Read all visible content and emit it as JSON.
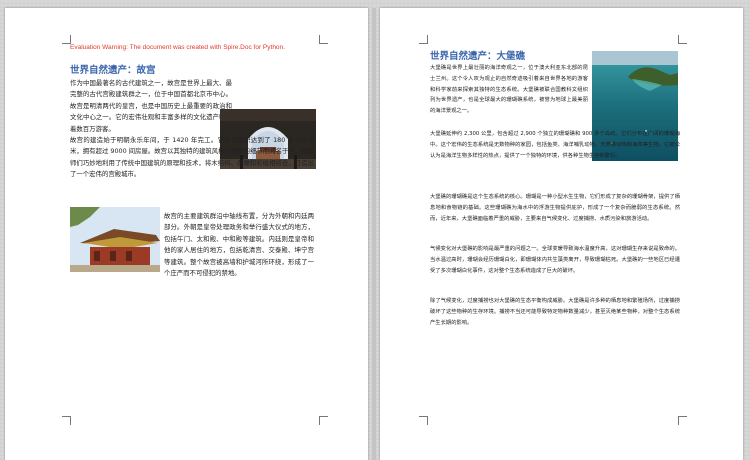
{
  "document": {
    "warning": "Evaluation Warning: The document was created with Spire.Doc for Python.",
    "page1": {
      "heading": "世界自然遗产：故宫",
      "p1": "作为中国最著名的古代建筑之一，故宫是世界上最大、最完整的古代宫殿建筑群之一，位于中国首都北京市中心。故宫是明清两代的皇宫，也是中国历史上最重要的政治和文化中心之一。它的宏伟壮观和丰富多样的文化遗产吸引着数百万游客。",
      "p2": "故宫的建造始于明朝永乐年间，于 1420 年完工。它的总面积达到了 180 多万平方米，拥有超过 9000 间房屋。故宫以其独特的建筑风格和精美的细节而闻名于世。建筑师们巧妙地利用了传统中国建筑的原理和技术，将木结构、石雕和彩绘相结合，打造出了一个宏伟的宫殿城市。",
      "p3": "故宫的主要建筑群沿中轴线布置，分为外朝和内廷两部分。外朝是皇帝处理政务和举行盛大仪式的地方，包括午门、太和殿、中和殿等建筑。内廷则是皇帝和他的家人居住的地方，包括乾清宫、交泰殿、坤宁宫等建筑。整个故宫被高墙和护城河所环绕，形成了一个庄严而不可侵犯的禁地。"
    },
    "page2": {
      "heading": "世界自然遗产：大堡礁",
      "p1": "大堡礁是世界上最壮丽的海洋奇观之一，位于澳大利亚东北部的昆士兰州。这个令人叹为观止的自然奇迹吸引着来自世界各地的游客和科学家前来探索其独特的生态系统。大堡礁被联合国教科文组织列为世界遗产，也是全球最大的珊瑚礁系统，被誉为地球上最美丽的海洋景观之一。",
      "p2": "大堡礁延伸约 2,300 公里，包含超过 2,900 个独立的珊瑚礁和 900 多个岛屿。它们分布在广阔的珊瑚海中。这个宏伟的生态系统是无数物种的家园，包括鱼类、海洋哺乳动物、无脊椎动物和海草等生物。它被公认为是海洋生物多样性的热点，提供了一个独特的环境，供各种生物生存和繁衍。",
      "p3": "大堡礁的珊瑚礁是这个生态系统的核心。珊瑚是一种小型水生生物，它们形成了复杂的珊瑚骨架，提供了栖息地和食物链的基础。这些珊瑚礁为海水中的浮游生物提供庇护，形成了一个复杂而脆弱的生态系统。然而，近年来，大堡礁面临着严重的威胁，主要来自气候变化、过度捕捞、水质污染和旅游活动。",
      "p4": "气候变化对大堡礁的影响是最严重的问题之一。全球变暖导致海水温度升高，这对珊瑚生存来说是致命的。当水温过高时，珊瑚会经历珊瑚白化，即珊瑚体内共生藻类离开，导致珊瑚枯死。大堡礁的一些地区已经遭受了多次珊瑚白化事件，这对整个生态系统造成了巨大的破坏。",
      "p5": "除了气候变化，过度捕捞也对大堡礁的生态平衡构成威胁。大堡礁是许多种的栖息地和繁殖场所，过度捕捞破坏了这些物种的生存环境。捕捞不当还可能导致特定物种数量减少，甚至灭绝某些物种，对整个生态系统产生长期的影响。"
    },
    "colors": {
      "heading": "#3a66ad",
      "warning": "#e03a2f",
      "text": "#222222"
    }
  }
}
